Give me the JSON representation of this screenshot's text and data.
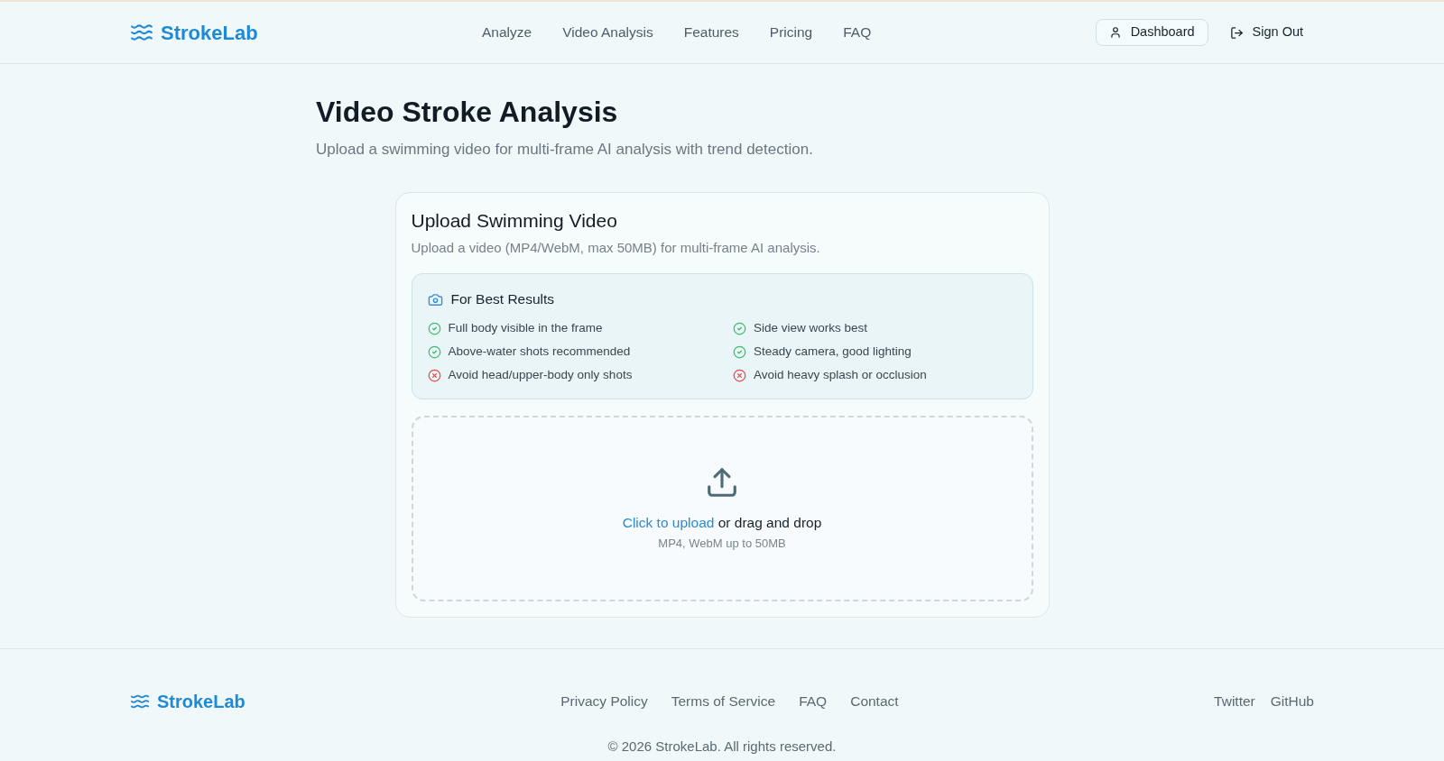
{
  "header": {
    "logo": "StrokeLab",
    "nav": [
      {
        "label": "Analyze"
      },
      {
        "label": "Video Analysis"
      },
      {
        "label": "Features"
      },
      {
        "label": "Pricing"
      },
      {
        "label": "FAQ"
      }
    ],
    "dashboard_button": "Dashboard",
    "sign_out_button": "Sign Out"
  },
  "page": {
    "title": "Video Stroke Analysis",
    "subtitle": "Upload a swimming video for multi-frame AI analysis with trend detection."
  },
  "upload_card": {
    "title": "Upload Swimming Video",
    "description": "Upload a video (MP4/WebM, max 50MB) for multi-frame AI analysis.",
    "tips": {
      "title": "For Best Results",
      "items": [
        {
          "kind": "do",
          "text": "Full body visible in the frame"
        },
        {
          "kind": "do",
          "text": "Side view works best"
        },
        {
          "kind": "do",
          "text": "Above-water shots recommended"
        },
        {
          "kind": "do",
          "text": "Steady camera, good lighting"
        },
        {
          "kind": "avoid",
          "text": "Avoid head/upper-body only shots"
        },
        {
          "kind": "avoid",
          "text": "Avoid heavy splash or occlusion"
        }
      ]
    },
    "dropzone": {
      "link": "Click to upload",
      "text": "or drag and drop",
      "hint": "MP4, WebM up to 50MB"
    }
  },
  "footer": {
    "logo": "StrokeLab",
    "links": [
      "Privacy Policy",
      "Terms of Service",
      "FAQ",
      "Contact"
    ],
    "social": [
      "Twitter",
      "GitHub"
    ],
    "copyright": "© 2026 StrokeLab. All rights reserved."
  }
}
